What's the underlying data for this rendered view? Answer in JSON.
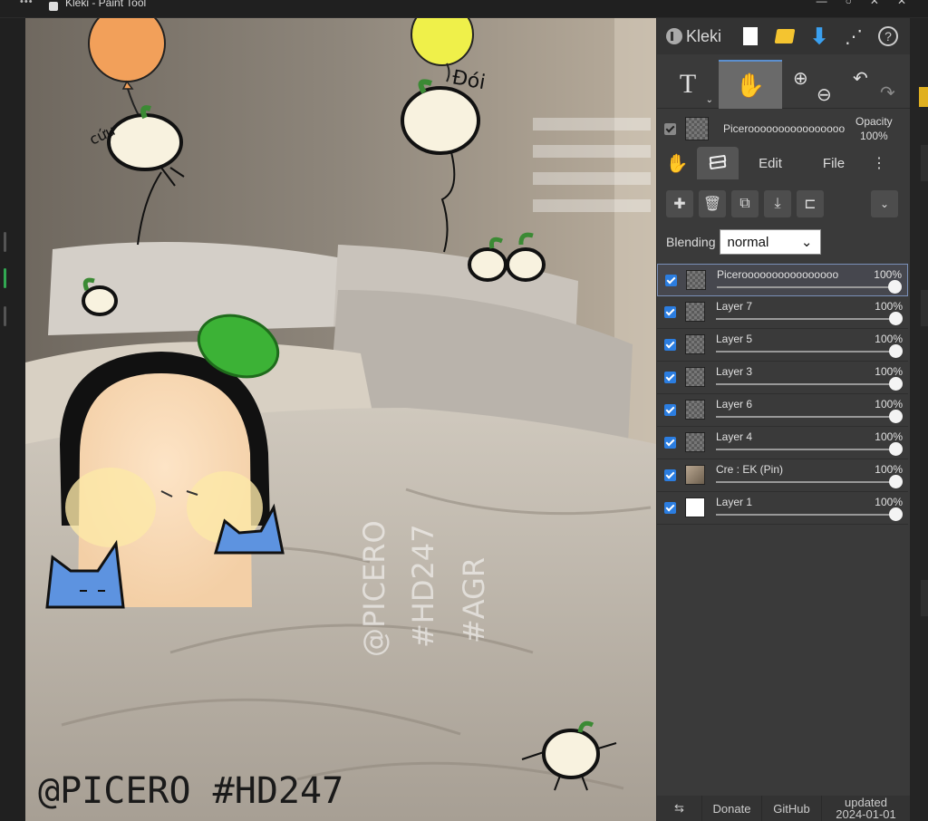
{
  "window": {
    "title": "Kleki - Paint Tool",
    "dots": "•••"
  },
  "topbar": {
    "logo": "Kleki",
    "download_glyph": "⬇",
    "share_glyph": "⋰",
    "help_glyph": "?"
  },
  "tools": {
    "text_glyph": "T",
    "text_caret": "⌄",
    "hand_glyph": "✋",
    "zoom_in_glyph": "⊕",
    "zoom_out_glyph": "⊖",
    "undo_glyph": "↶",
    "redo_glyph": "↷"
  },
  "active_layer": {
    "name": "Piceroooooooooooooooo",
    "opacity_label": "Opacity",
    "opacity_value": "100%"
  },
  "tabs": {
    "hand_glyph": "✋",
    "edit": "Edit",
    "file": "File",
    "more": "⋮"
  },
  "layer_tools": {
    "add": "✚",
    "delete": "🗑",
    "duplicate": "⧉",
    "merge": "⤓",
    "transform": "⊏",
    "dropdown": "⌄"
  },
  "blending": {
    "label": "Blending",
    "value": "normal",
    "caret": "⌄"
  },
  "layers": [
    {
      "name": "Piceroooooooooooooooo",
      "opacity": "100%",
      "thumb": "checker",
      "selected": true
    },
    {
      "name": "Layer 7",
      "opacity": "100%",
      "thumb": "checker",
      "selected": false
    },
    {
      "name": "Layer 5",
      "opacity": "100%",
      "thumb": "checker",
      "selected": false
    },
    {
      "name": "Layer 3",
      "opacity": "100%",
      "thumb": "checker",
      "selected": false
    },
    {
      "name": "Layer 6",
      "opacity": "100%",
      "thumb": "checker",
      "selected": false
    },
    {
      "name": "Layer 4",
      "opacity": "100%",
      "thumb": "checker",
      "selected": false
    },
    {
      "name": "Cre : EK (Pin)",
      "opacity": "100%",
      "thumb": "photo",
      "selected": false
    },
    {
      "name": "Layer 1",
      "opacity": "100%",
      "thumb": "white",
      "selected": false
    }
  ],
  "footer": {
    "swap": "⇆",
    "donate": "Donate",
    "github": "GitHub",
    "updated": "updated",
    "updated_date": "2024-01-01"
  },
  "canvas": {
    "watermark_bottom": "@PICERO #HD247",
    "watermark_vertical_1": "@PICERO",
    "watermark_vertical_2": "#HD247",
    "watermark_vertical_3": "#AGR",
    "doodle_text_left": "cứu",
    "doodle_text_right": "Đói"
  },
  "colors": {
    "accent": "#5b8fd0",
    "checkbox": "#2b7de0",
    "download": "#3aa0f0",
    "folder": "#f4c430"
  }
}
